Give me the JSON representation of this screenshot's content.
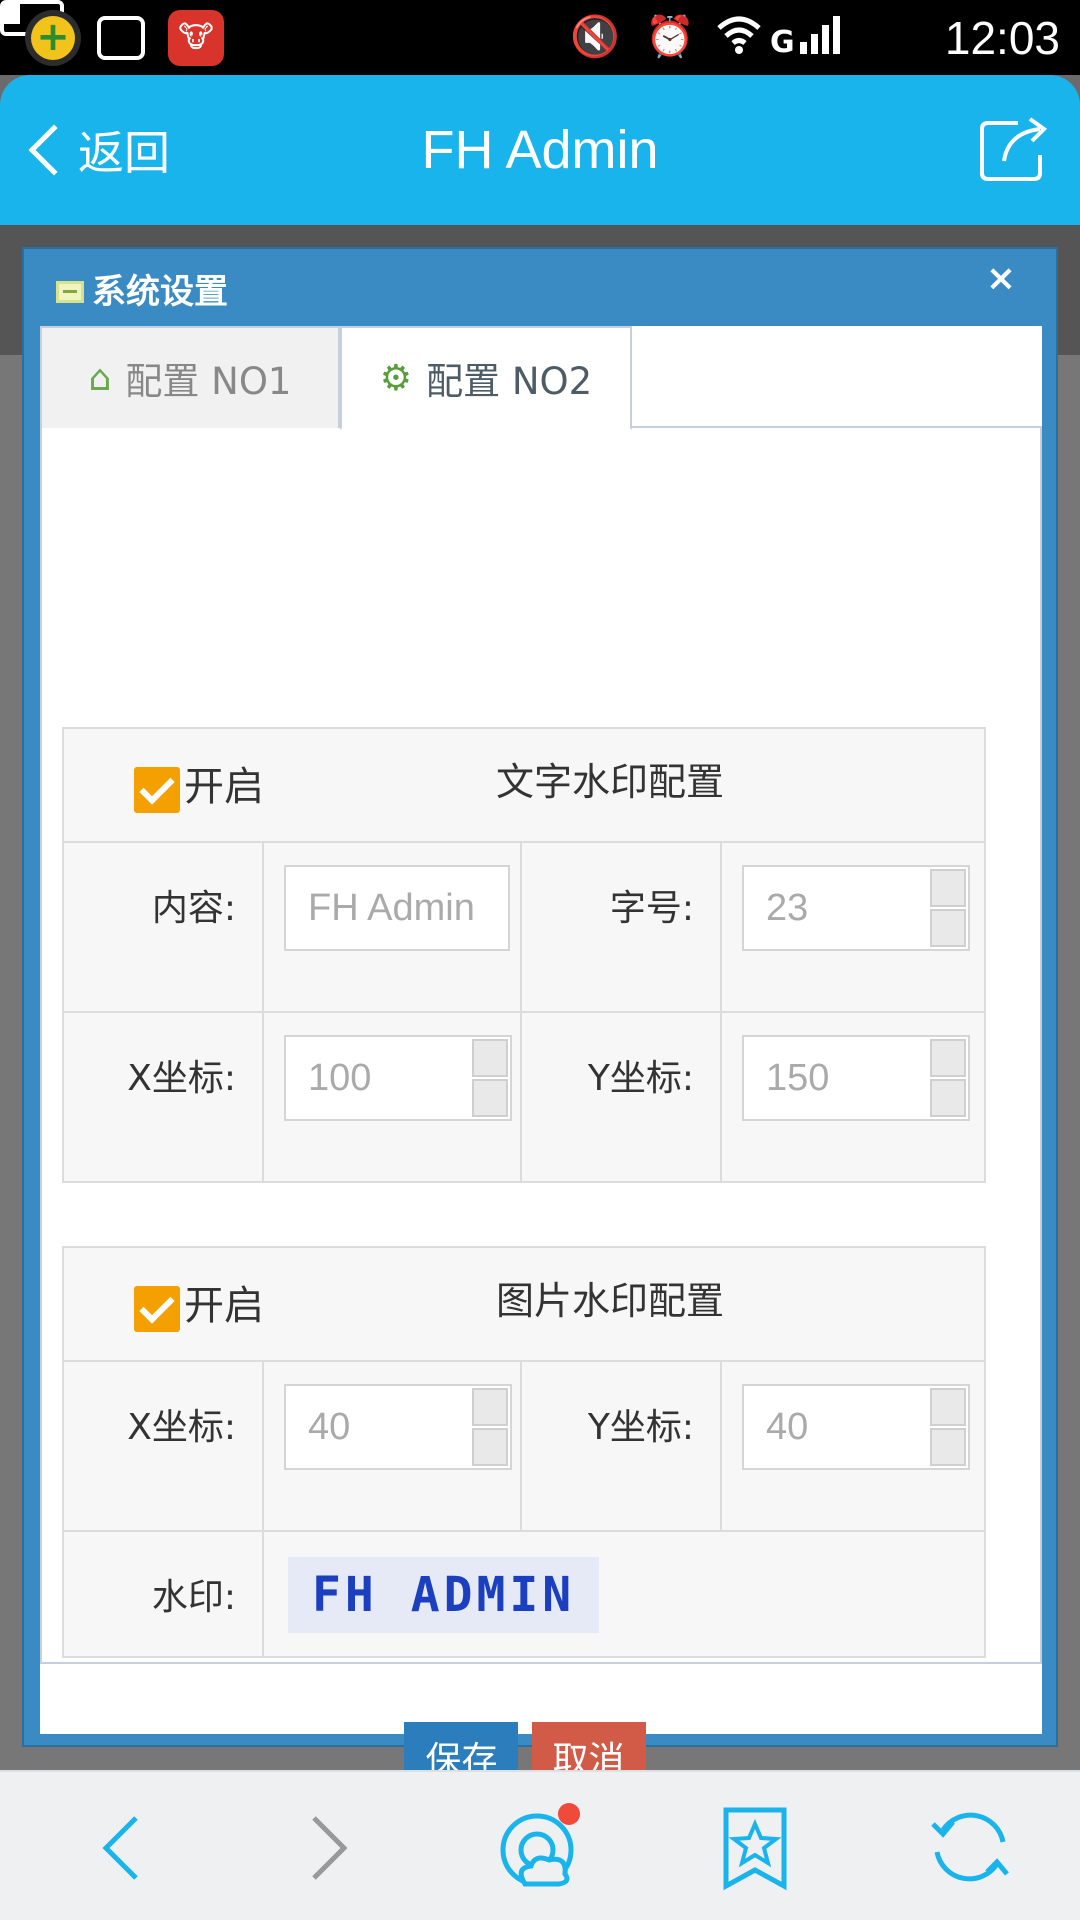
{
  "status_bar": {
    "time": "12:03"
  },
  "header": {
    "back_label": "返回",
    "title": "FH Admin"
  },
  "dialog": {
    "title": "系统设置",
    "close": "×",
    "tabs": [
      {
        "label": "配置 NO1",
        "icon": "home-icon",
        "active": false
      },
      {
        "label": "配置 NO2",
        "icon": "gear-icon",
        "active": true
      }
    ],
    "text_watermark": {
      "enabled_label": "开启",
      "enabled": true,
      "title": "文字水印配置",
      "content_label": "内容:",
      "content_value": "FH Admin",
      "font_size_label": "字号:",
      "font_size_value": "23",
      "x_label": "X坐标:",
      "x_value": "100",
      "y_label": "Y坐标:",
      "y_value": "150"
    },
    "image_watermark": {
      "enabled_label": "开启",
      "enabled": true,
      "title": "图片水印配置",
      "x_label": "X坐标:",
      "x_value": "40",
      "y_label": "Y坐标:",
      "y_value": "40",
      "watermark_label": "水印:",
      "watermark_preview": "FH ADMIN"
    },
    "buttons": {
      "save": "保存",
      "cancel": "取消"
    }
  },
  "colors": {
    "header": "#1ab4ec",
    "dialog_frame": "#3a8bc4",
    "checkbox": "#f4a000",
    "save": "#2b7dbc",
    "cancel": "#d15b47"
  }
}
